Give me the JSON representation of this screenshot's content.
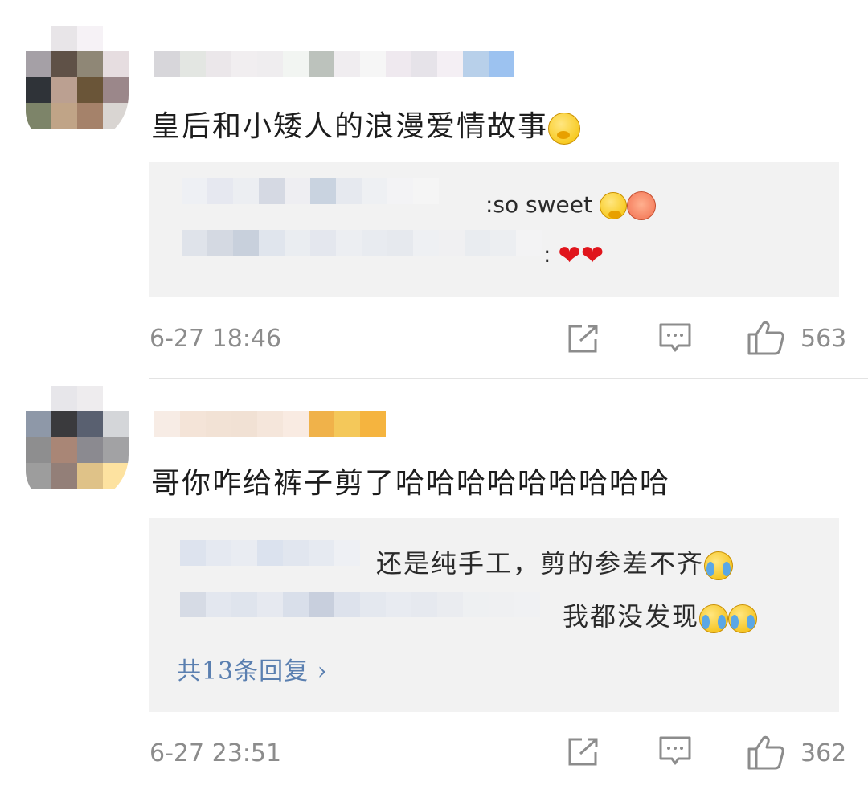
{
  "comments": [
    {
      "text": "皇后和小矮人的浪漫爱情故事",
      "text_emoji": "shy-face-emoji",
      "replies": [
        {
          "text": ":so sweet",
          "emojis": [
            "shy-face-emoji",
            "pig-face-emoji"
          ]
        },
        {
          "text": ":",
          "emojis": [
            "heart-emoji",
            "heart-emoji"
          ]
        }
      ],
      "timestamp": "6-27 18:46",
      "likes": "563"
    },
    {
      "text": "哥你咋给裤子剪了哈哈哈哈哈哈哈哈哈",
      "replies": [
        {
          "text": "还是纯手工，剪的参差不齐",
          "emojis": [
            "laughing-tears-emoji"
          ]
        },
        {
          "text": "我都没发现",
          "emojis": [
            "laughing-tears-emoji",
            "laughing-tears-emoji"
          ]
        }
      ],
      "more_replies": "共13条回复 ›",
      "timestamp": "6-27 23:51",
      "likes": "362"
    }
  ],
  "icons": {
    "share": "share-icon",
    "reply": "comment-icon",
    "like": "thumbs-up-icon"
  },
  "colors": {
    "reply_box_bg": "#f2f2f2",
    "meta_text": "#8c8c8c",
    "more_replies_link": "#5a7fb0",
    "heart": "#e0151c"
  }
}
